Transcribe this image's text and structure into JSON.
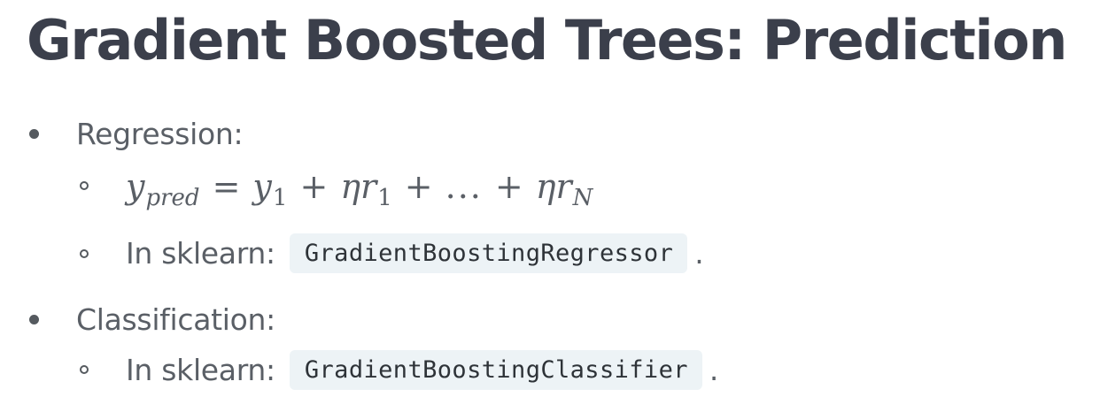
{
  "title": "Gradient Boosted Trees: Prediction",
  "items": [
    {
      "label": "Regression:",
      "subitems": [
        {
          "formula": {
            "y": "y",
            "y_sub": "pred",
            "eq": "=",
            "y1": "y",
            "y1_sub": "1",
            "plus1": "+",
            "eta1": "ηr",
            "r1_sub": "1",
            "plus2": "+",
            "dots": "...",
            "plus3": "+",
            "etaN": "ηr",
            "rN_sub": "N"
          }
        },
        {
          "prefix": "In sklearn:",
          "code": "GradientBoostingRegressor",
          "suffix": "."
        }
      ]
    },
    {
      "label": "Classification:",
      "subitems": [
        {
          "prefix": "In sklearn:",
          "code": "GradientBoostingClassifier",
          "suffix": "."
        }
      ]
    }
  ]
}
